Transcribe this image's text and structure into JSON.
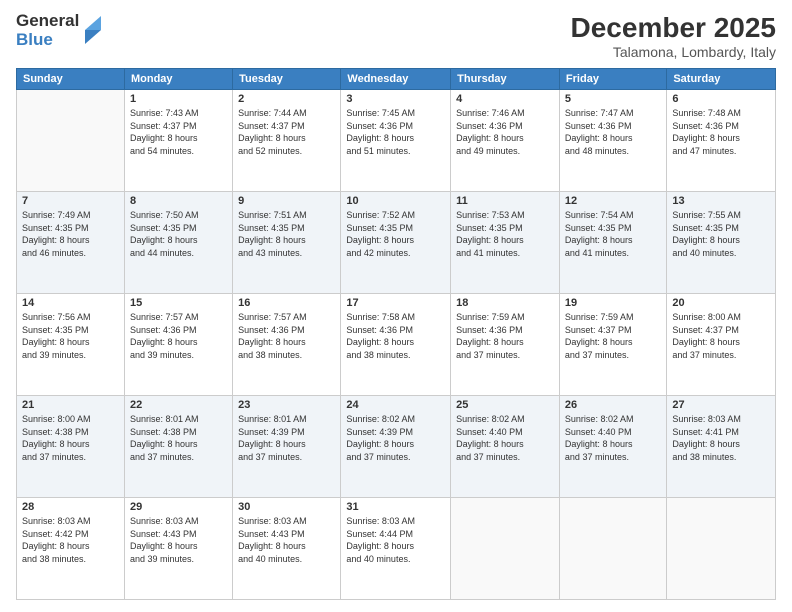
{
  "logo": {
    "general": "General",
    "blue": "Blue"
  },
  "title": "December 2025",
  "location": "Talamona, Lombardy, Italy",
  "days_of_week": [
    "Sunday",
    "Monday",
    "Tuesday",
    "Wednesday",
    "Thursday",
    "Friday",
    "Saturday"
  ],
  "weeks": [
    [
      {
        "day": "",
        "info": ""
      },
      {
        "day": "1",
        "info": "Sunrise: 7:43 AM\nSunset: 4:37 PM\nDaylight: 8 hours\nand 54 minutes."
      },
      {
        "day": "2",
        "info": "Sunrise: 7:44 AM\nSunset: 4:37 PM\nDaylight: 8 hours\nand 52 minutes."
      },
      {
        "day": "3",
        "info": "Sunrise: 7:45 AM\nSunset: 4:36 PM\nDaylight: 8 hours\nand 51 minutes."
      },
      {
        "day": "4",
        "info": "Sunrise: 7:46 AM\nSunset: 4:36 PM\nDaylight: 8 hours\nand 49 minutes."
      },
      {
        "day": "5",
        "info": "Sunrise: 7:47 AM\nSunset: 4:36 PM\nDaylight: 8 hours\nand 48 minutes."
      },
      {
        "day": "6",
        "info": "Sunrise: 7:48 AM\nSunset: 4:36 PM\nDaylight: 8 hours\nand 47 minutes."
      }
    ],
    [
      {
        "day": "7",
        "info": "Sunrise: 7:49 AM\nSunset: 4:35 PM\nDaylight: 8 hours\nand 46 minutes."
      },
      {
        "day": "8",
        "info": "Sunrise: 7:50 AM\nSunset: 4:35 PM\nDaylight: 8 hours\nand 44 minutes."
      },
      {
        "day": "9",
        "info": "Sunrise: 7:51 AM\nSunset: 4:35 PM\nDaylight: 8 hours\nand 43 minutes."
      },
      {
        "day": "10",
        "info": "Sunrise: 7:52 AM\nSunset: 4:35 PM\nDaylight: 8 hours\nand 42 minutes."
      },
      {
        "day": "11",
        "info": "Sunrise: 7:53 AM\nSunset: 4:35 PM\nDaylight: 8 hours\nand 41 minutes."
      },
      {
        "day": "12",
        "info": "Sunrise: 7:54 AM\nSunset: 4:35 PM\nDaylight: 8 hours\nand 41 minutes."
      },
      {
        "day": "13",
        "info": "Sunrise: 7:55 AM\nSunset: 4:35 PM\nDaylight: 8 hours\nand 40 minutes."
      }
    ],
    [
      {
        "day": "14",
        "info": "Sunrise: 7:56 AM\nSunset: 4:35 PM\nDaylight: 8 hours\nand 39 minutes."
      },
      {
        "day": "15",
        "info": "Sunrise: 7:57 AM\nSunset: 4:36 PM\nDaylight: 8 hours\nand 39 minutes."
      },
      {
        "day": "16",
        "info": "Sunrise: 7:57 AM\nSunset: 4:36 PM\nDaylight: 8 hours\nand 38 minutes."
      },
      {
        "day": "17",
        "info": "Sunrise: 7:58 AM\nSunset: 4:36 PM\nDaylight: 8 hours\nand 38 minutes."
      },
      {
        "day": "18",
        "info": "Sunrise: 7:59 AM\nSunset: 4:36 PM\nDaylight: 8 hours\nand 37 minutes."
      },
      {
        "day": "19",
        "info": "Sunrise: 7:59 AM\nSunset: 4:37 PM\nDaylight: 8 hours\nand 37 minutes."
      },
      {
        "day": "20",
        "info": "Sunrise: 8:00 AM\nSunset: 4:37 PM\nDaylight: 8 hours\nand 37 minutes."
      }
    ],
    [
      {
        "day": "21",
        "info": "Sunrise: 8:00 AM\nSunset: 4:38 PM\nDaylight: 8 hours\nand 37 minutes."
      },
      {
        "day": "22",
        "info": "Sunrise: 8:01 AM\nSunset: 4:38 PM\nDaylight: 8 hours\nand 37 minutes."
      },
      {
        "day": "23",
        "info": "Sunrise: 8:01 AM\nSunset: 4:39 PM\nDaylight: 8 hours\nand 37 minutes."
      },
      {
        "day": "24",
        "info": "Sunrise: 8:02 AM\nSunset: 4:39 PM\nDaylight: 8 hours\nand 37 minutes."
      },
      {
        "day": "25",
        "info": "Sunrise: 8:02 AM\nSunset: 4:40 PM\nDaylight: 8 hours\nand 37 minutes."
      },
      {
        "day": "26",
        "info": "Sunrise: 8:02 AM\nSunset: 4:40 PM\nDaylight: 8 hours\nand 37 minutes."
      },
      {
        "day": "27",
        "info": "Sunrise: 8:03 AM\nSunset: 4:41 PM\nDaylight: 8 hours\nand 38 minutes."
      }
    ],
    [
      {
        "day": "28",
        "info": "Sunrise: 8:03 AM\nSunset: 4:42 PM\nDaylight: 8 hours\nand 38 minutes."
      },
      {
        "day": "29",
        "info": "Sunrise: 8:03 AM\nSunset: 4:43 PM\nDaylight: 8 hours\nand 39 minutes."
      },
      {
        "day": "30",
        "info": "Sunrise: 8:03 AM\nSunset: 4:43 PM\nDaylight: 8 hours\nand 40 minutes."
      },
      {
        "day": "31",
        "info": "Sunrise: 8:03 AM\nSunset: 4:44 PM\nDaylight: 8 hours\nand 40 minutes."
      },
      {
        "day": "",
        "info": ""
      },
      {
        "day": "",
        "info": ""
      },
      {
        "day": "",
        "info": ""
      }
    ]
  ]
}
